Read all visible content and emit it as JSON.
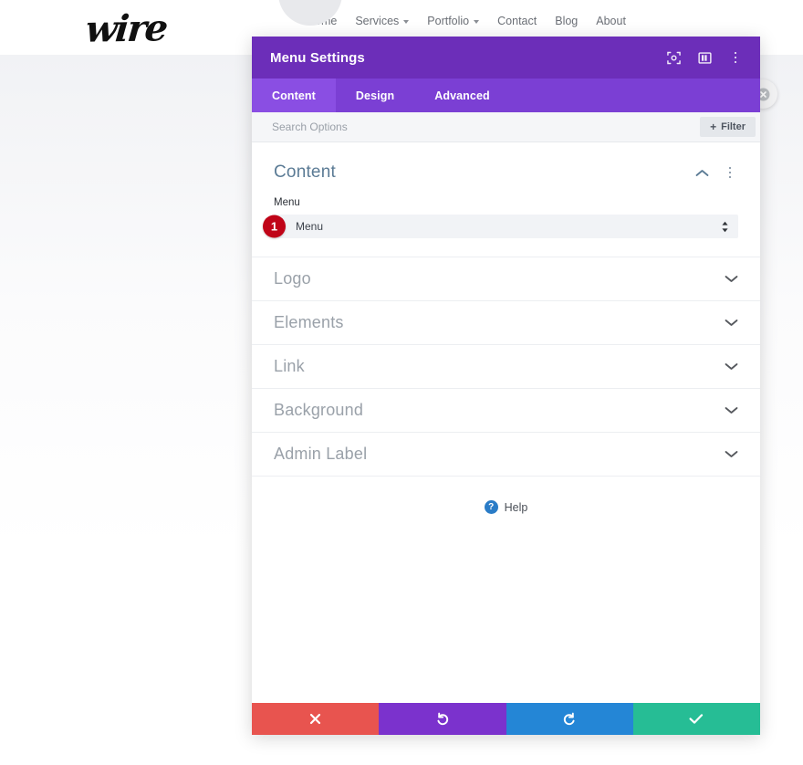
{
  "site": {
    "logo_text": "wire",
    "nav": [
      {
        "label": "Home",
        "has_caret": false
      },
      {
        "label": "Services",
        "has_caret": true
      },
      {
        "label": "Portfolio",
        "has_caret": true
      },
      {
        "label": "Contact",
        "has_caret": false
      },
      {
        "label": "Blog",
        "has_caret": false
      },
      {
        "label": "About",
        "has_caret": false
      }
    ]
  },
  "modal": {
    "title": "Menu Settings",
    "header_icons": [
      {
        "name": "focus-target-icon"
      },
      {
        "name": "split-layout-icon"
      },
      {
        "name": "more-vertical-icon"
      }
    ],
    "tabs": [
      {
        "label": "Content",
        "active": true
      },
      {
        "label": "Design",
        "active": false
      },
      {
        "label": "Advanced",
        "active": false
      }
    ],
    "search": {
      "placeholder": "Search Options",
      "value": ""
    },
    "filter_label": "Filter",
    "content_section": {
      "title": "Content",
      "field_label": "Menu",
      "select_value": "Menu",
      "badge": "1",
      "collapse_icon": "chevron-up-icon",
      "menu_icon": "more-vertical-icon"
    },
    "sections": [
      {
        "label": "Logo"
      },
      {
        "label": "Elements"
      },
      {
        "label": "Link"
      },
      {
        "label": "Background"
      },
      {
        "label": "Admin Label"
      }
    ],
    "help": {
      "label": "Help",
      "icon_glyph": "?"
    },
    "actions": [
      {
        "name": "cancel",
        "icon": "close-x-icon",
        "color": "#e8544f"
      },
      {
        "name": "undo",
        "icon": "undo-icon",
        "color": "#7b32cd"
      },
      {
        "name": "redo",
        "icon": "redo-icon",
        "color": "#2486d6"
      },
      {
        "name": "save",
        "icon": "checkmark-icon",
        "color": "#26bd95"
      }
    ]
  },
  "colors": {
    "header_purple": "#6c2eb9",
    "tabbar_purple": "#7b3fd4",
    "active_tab_purple": "#8a4ee3",
    "badge_red": "#c00418",
    "help_blue": "#2a7cc7"
  }
}
